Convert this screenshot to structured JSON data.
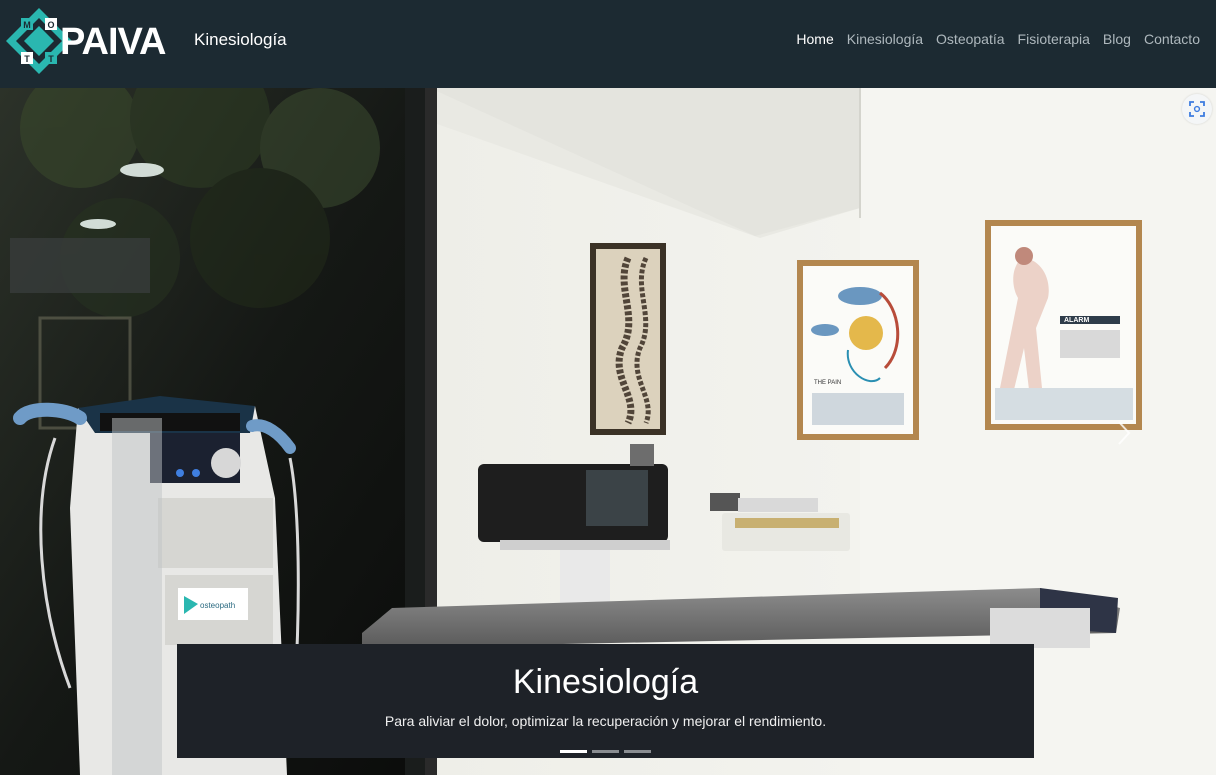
{
  "brand": {
    "logo_letters": [
      "M",
      "O",
      "T",
      "T"
    ],
    "name": "PAIVA",
    "subtitle": "Kinesiología",
    "accent": "#2ab7b0"
  },
  "nav": {
    "items": [
      {
        "label": "Home",
        "active": true
      },
      {
        "label": "Kinesiología",
        "active": false
      },
      {
        "label": "Osteopatía",
        "active": false
      },
      {
        "label": "Fisioterapia",
        "active": false
      },
      {
        "label": "Blog",
        "active": false
      },
      {
        "label": "Contacto",
        "active": false
      }
    ]
  },
  "hero": {
    "caption_title": "Kinesiología",
    "caption_text": "Para aliviar el dolor, optimizar la recuperación y mejorar el rendimiento.",
    "slides_total": 3,
    "active_slide": 1,
    "fullscreen_icon": "fullscreen-icon",
    "next_icon": "chevron-right-icon"
  },
  "scene": {
    "poster_pain_title": "THE PAIN",
    "poster_alarm_title": "ALARM",
    "device_brand": "osteopath"
  },
  "colors": {
    "navbar": "#1c2a32",
    "caption_bg": "#1e2228",
    "wall": "#f3f3ee"
  }
}
